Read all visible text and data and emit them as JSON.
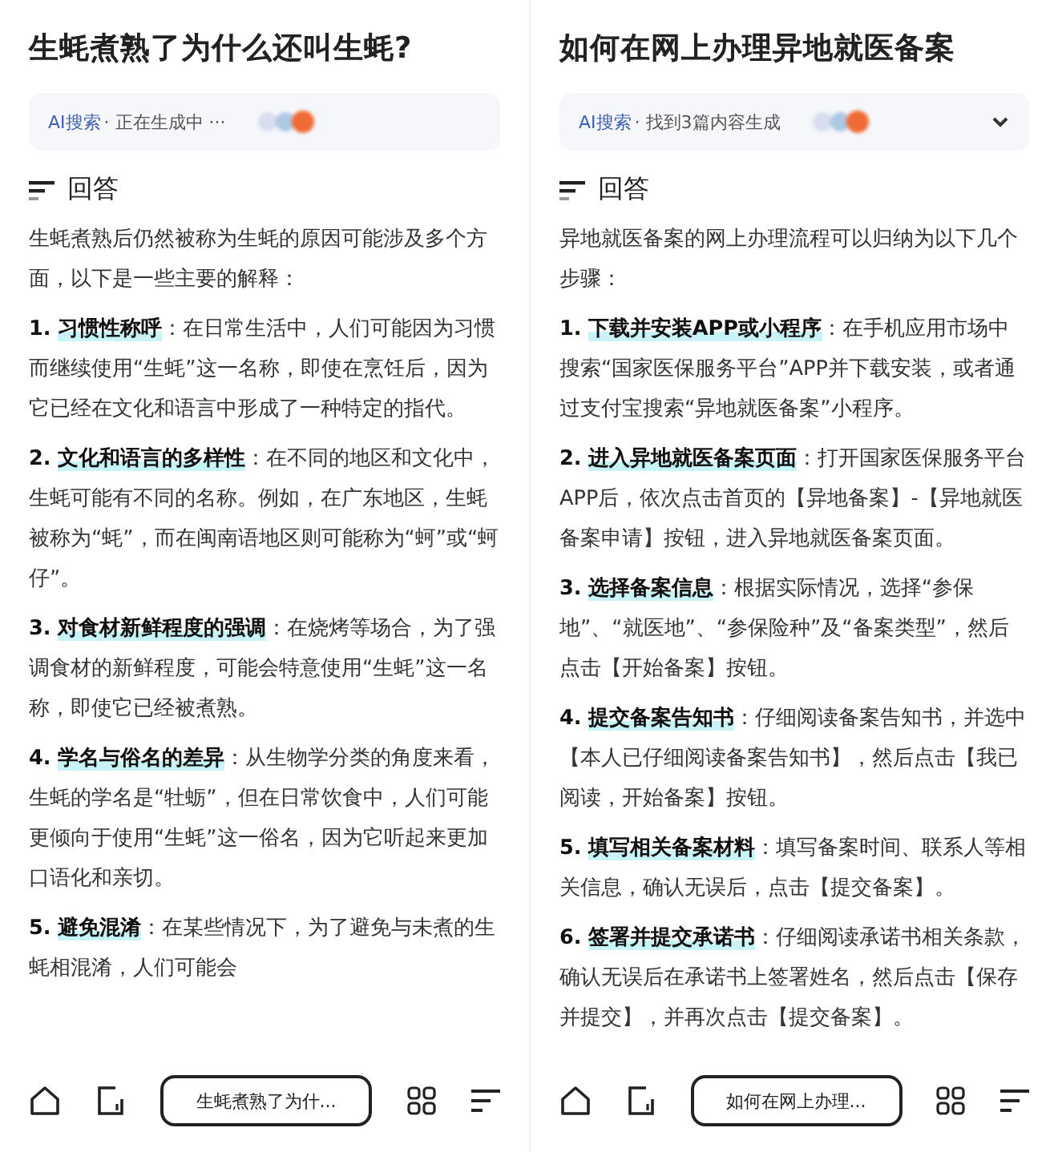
{
  "panels": [
    {
      "title": "生蚝煮熟了为什么还叫生蚝?",
      "ai_bar": {
        "label": "AI搜索",
        "status": "· 正在生成中 ···",
        "collapsible": false
      },
      "section_heading": "回答",
      "intro": "生蚝煮熟后仍然被称为生蚝的原因可能涉及多个方面，以下是一些主要的解释：",
      "points": [
        {
          "number": "1.",
          "term": "习惯性称呼",
          "text": "：在日常生活中，人们可能因为习惯而继续使用“生蚝”这一名称，即使在烹饪后，因为它已经在文化和语言中形成了一种特定的指代。"
        },
        {
          "number": "2.",
          "term": "文化和语言的多样性",
          "text": "：在不同的地区和文化中，生蚝可能有不同的名称。例如，在广东地区，生蚝被称为“蚝”，而在闽南语地区则可能称为“蚵”或“蚵仔”。"
        },
        {
          "number": "3.",
          "term": "对食材新鲜程度的强调",
          "text": "：在烧烤等场合，为了强调食材的新鲜程度，可能会特意使用“生蚝”这一名称，即使它已经被煮熟。"
        },
        {
          "number": "4.",
          "term": "学名与俗名的差异",
          "text": "：从生物学分类的角度来看，生蚝的学名是“牡蛎”，但在日常饮食中，人们可能更倾向于使用“生蚝”这一俗名，因为它听起来更加口语化和亲切。"
        },
        {
          "number": "5.",
          "term": "避免混淆",
          "text": "：在某些情况下，为了避免与未煮的生蚝相混淆，人们可能会"
        }
      ],
      "query_button": "生蚝煮熟了为什..."
    },
    {
      "title": "如何在网上办理异地就医备案",
      "ai_bar": {
        "label": "AI搜索",
        "status": "· 找到3篇内容生成",
        "collapsible": true
      },
      "section_heading": "回答",
      "intro": "异地就医备案的网上办理流程可以归纳为以下几个步骤：",
      "points": [
        {
          "number": "1.",
          "term": "下载并安装APP或小程序",
          "text": "：在手机应用市场中搜索“国家医保服务平台”APP并下载安装，或者通过支付宝搜索“异地就医备案”小程序。"
        },
        {
          "number": "2.",
          "term": "进入异地就医备案页面",
          "text": "：打开国家医保服务平台APP后，依次点击首页的【异地备案】-【异地就医备案申请】按钮，进入异地就医备案页面。"
        },
        {
          "number": "3.",
          "term": "选择备案信息",
          "text": "：根据实际情况，选择“参保地”、“就医地”、“参保险种”及“备案类型”，然后点击【开始备案】按钮。"
        },
        {
          "number": "4.",
          "term": "提交备案告知书",
          "text": "：仔细阅读备案告知书，并选中【本人已仔细阅读备案告知书】，然后点击【我已阅读，开始备案】按钮。"
        },
        {
          "number": "5.",
          "term": "填写相关备案材料",
          "text": "：填写备案时间、联系人等相关信息，确认无误后，点击【提交备案】。"
        },
        {
          "number": "6.",
          "term": "签署并提交承诺书",
          "text": "：仔细阅读承诺书相关条款，确认无误后在承诺书上签署姓名，然后点击【保存并提交】，并再次点击【提交备案】。"
        }
      ],
      "query_button": "如何在网上办理..."
    }
  ]
}
